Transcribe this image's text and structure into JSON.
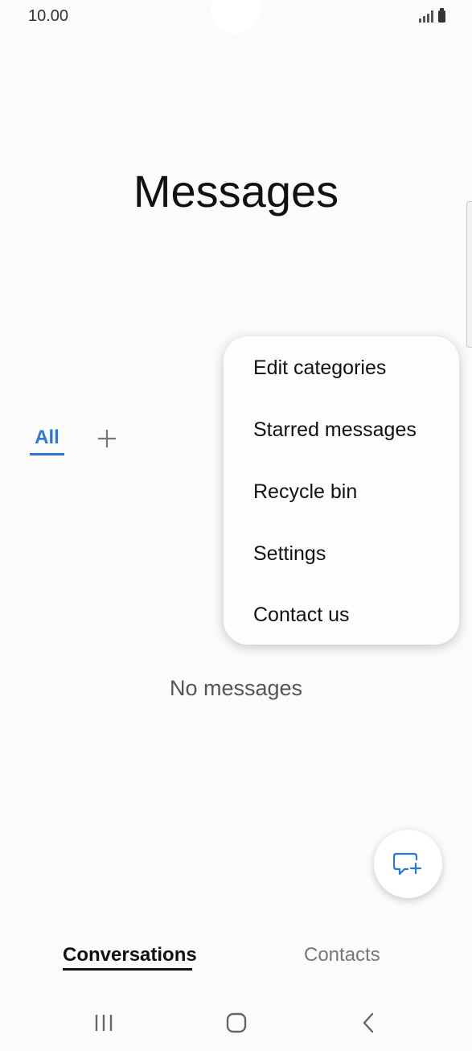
{
  "status_bar": {
    "time": "10.00",
    "icons": [
      "signal-icon",
      "battery-icon"
    ]
  },
  "header": {
    "title": "Messages"
  },
  "categories": {
    "active_tab": "All",
    "add_icon": "plus-icon"
  },
  "menu": {
    "items": [
      {
        "label": "Edit categories"
      },
      {
        "label": "Starred messages"
      },
      {
        "label": "Recycle bin"
      },
      {
        "label": "Settings"
      },
      {
        "label": "Contact us"
      }
    ]
  },
  "main": {
    "empty_text": "No messages"
  },
  "fab": {
    "icon": "new-message-icon"
  },
  "bottom_tabs": {
    "conversations": "Conversations",
    "contacts": "Contacts"
  },
  "nav_bar": {
    "icons": [
      "recents-icon",
      "home-icon",
      "back-icon"
    ]
  },
  "colors": {
    "accent": "#2b78d1",
    "background": "#fbfbfb",
    "text_primary": "#111111",
    "text_secondary": "#777777"
  }
}
